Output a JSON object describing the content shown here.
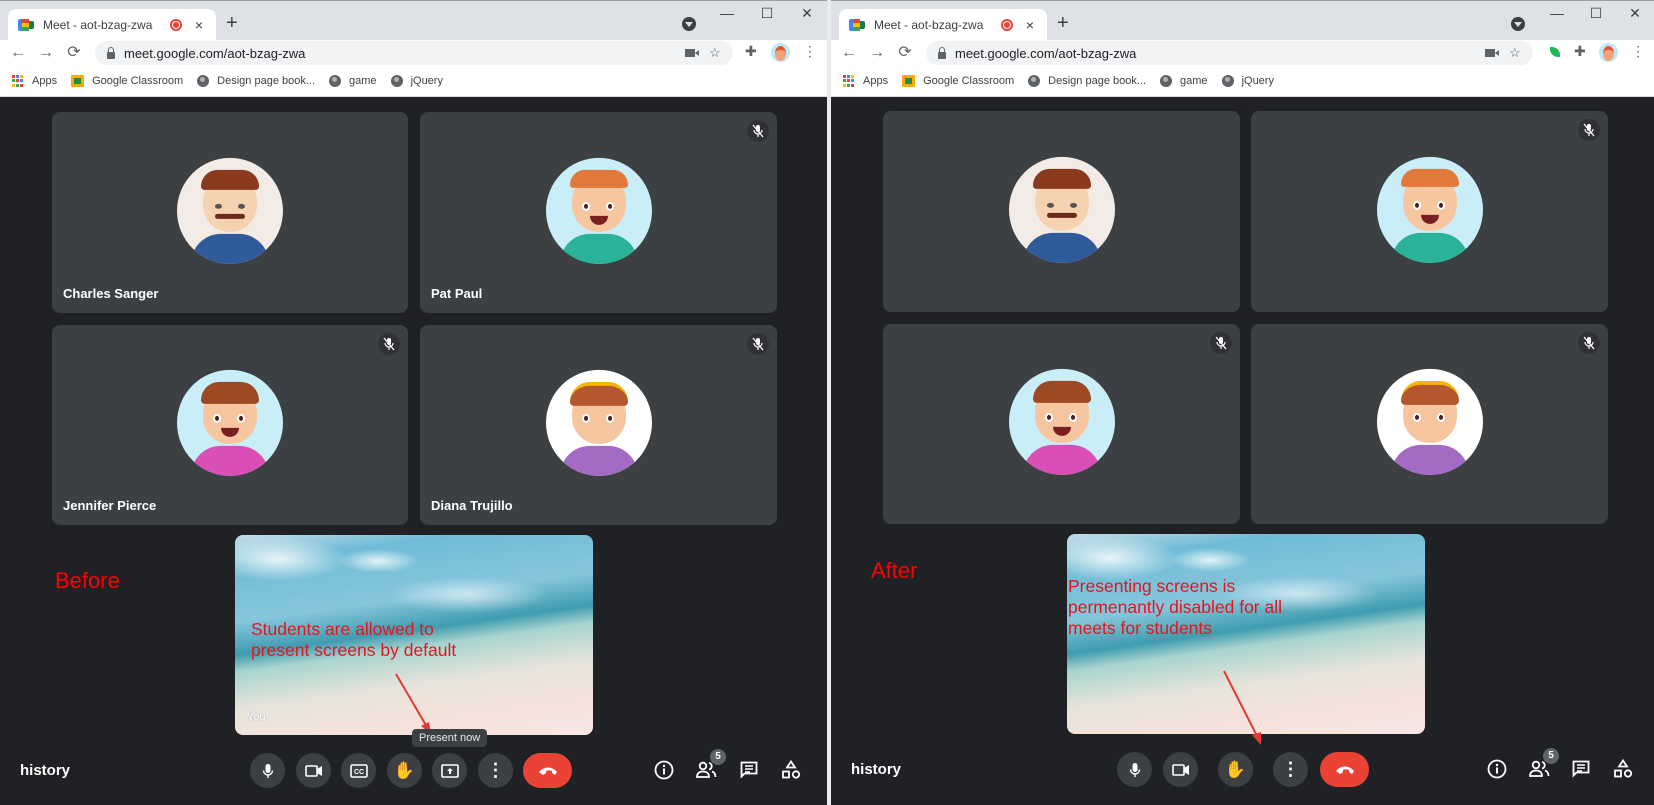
{
  "windows": [
    {
      "id": "before",
      "tab": {
        "title": "Meet - aot-bzag-zwa",
        "recording_indicator": "record-icon",
        "close": "×"
      },
      "new_tab": "+",
      "window_controls": {
        "minimize": "—",
        "maximize": "☐",
        "close": "✕"
      },
      "nav": {
        "back": "←",
        "forward": "→",
        "reload": "⟳"
      },
      "address": "meet.google.com/aot-bzag-zwa",
      "bookmarks": [
        {
          "icon": "apps-grid-icon",
          "label": "Apps"
        },
        {
          "icon": "google-classroom-icon",
          "label": "Google Classroom"
        },
        {
          "icon": "globe-icon",
          "label": "Design page book..."
        },
        {
          "icon": "globe-icon",
          "label": "game"
        },
        {
          "icon": "globe-icon",
          "label": "jQuery"
        }
      ],
      "participants": [
        {
          "name": "Charles Sanger",
          "muted": false,
          "avatar": "man-mustache"
        },
        {
          "name": "Pat Paul",
          "muted": true,
          "avatar": "boy"
        },
        {
          "name": "Jennifer Pierce",
          "muted": true,
          "avatar": "girl-braid"
        },
        {
          "name": "Diana Trujillo",
          "muted": true,
          "avatar": "girl-headband"
        }
      ],
      "self_view": {
        "label": "You"
      },
      "annotation_title": "Before",
      "annotation_text": "Students are allowed to present screens by default",
      "tooltip": "Present now",
      "meeting_name": "history",
      "controls": [
        "mic",
        "camera",
        "captions",
        "raise-hand",
        "present",
        "more",
        "end-call"
      ],
      "people_count": "5"
    },
    {
      "id": "after",
      "tab": {
        "title": "Meet - aot-bzag-zwa",
        "recording_indicator": "record-icon",
        "close": "×"
      },
      "new_tab": "+",
      "window_controls": {
        "minimize": "—",
        "maximize": "☐",
        "close": "✕"
      },
      "nav": {
        "back": "←",
        "forward": "→",
        "reload": "⟳"
      },
      "address": "meet.google.com/aot-bzag-zwa",
      "bookmarks": [
        {
          "icon": "apps-grid-icon",
          "label": "Apps"
        },
        {
          "icon": "google-classroom-icon",
          "label": "Google Classroom"
        },
        {
          "icon": "globe-icon",
          "label": "Design page book..."
        },
        {
          "icon": "globe-icon",
          "label": "game"
        },
        {
          "icon": "globe-icon",
          "label": "jQuery"
        }
      ],
      "participants": [
        {
          "name": "",
          "muted": false,
          "avatar": "man-mustache"
        },
        {
          "name": "",
          "muted": true,
          "avatar": "boy"
        },
        {
          "name": "",
          "muted": true,
          "avatar": "girl-braid"
        },
        {
          "name": "",
          "muted": true,
          "avatar": "girl-headband"
        }
      ],
      "annotation_title": "After",
      "annotation_text": "Presenting screens is permenantly disabled for all meets for students",
      "meeting_name": "history",
      "controls": [
        "mic",
        "camera",
        "raise-hand",
        "more",
        "end-call"
      ],
      "people_count": "5"
    }
  ],
  "colors": {
    "meet_bg": "#202124",
    "tile_bg": "#3c4043",
    "end_call": "#ea4335",
    "annotation_red": "#e8131c"
  }
}
